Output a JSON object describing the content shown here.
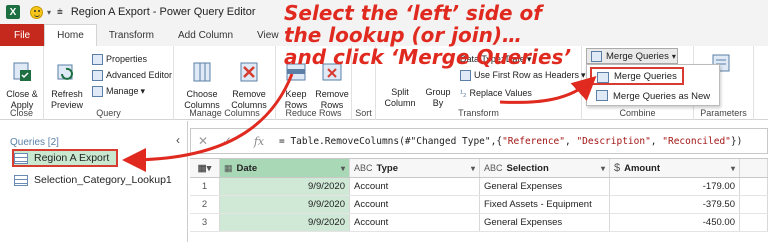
{
  "titlebar": {
    "title": "Region A Export - Power Query Editor",
    "app_logo": "X"
  },
  "tabs": [
    "File",
    "Home",
    "Transform",
    "Add Column",
    "View"
  ],
  "ribbon": {
    "close": {
      "close_apply": "Close &\nApply",
      "group": "Close"
    },
    "query": {
      "refresh": "Refresh\nPreview",
      "properties": "Properties",
      "advanced_editor": "Advanced Editor",
      "manage": "Manage",
      "group": "Query"
    },
    "manage_columns": {
      "choose": "Choose\nColumns",
      "remove": "Remove\nColumns",
      "group": "Manage Columns"
    },
    "reduce_rows": {
      "keep": "Keep\nRows",
      "remove": "Remove\nRows",
      "group": "Reduce Rows"
    },
    "sort": {
      "group": "Sort"
    },
    "transform": {
      "split": "Split\nColumn",
      "group_by": "Group\nBy",
      "data_type": "Data Type: Date",
      "first_row": "Use First Row as Headers",
      "replace": "Replace Values",
      "group": "Transform"
    },
    "combine": {
      "merge_queries": "Merge Queries",
      "group": "Combine"
    },
    "parameters": {
      "group": "Parameters"
    }
  },
  "merge_menu": {
    "items": [
      "Merge Queries",
      "Merge Queries as New"
    ]
  },
  "annotation": {
    "line1": "Select the ‘left’ side of",
    "line2": "the lookup (or join)…",
    "line3": "and click ‘Merge Queries’"
  },
  "queries": {
    "header": "Queries [2]",
    "items": [
      "Region A Export",
      "Selection_Category_Lookup1"
    ]
  },
  "formula": {
    "prefix": "= Table.RemoveColumns(#\"Changed Type\",{",
    "s1": "\"Reference\"",
    "s2": "\"Description\"",
    "s3": "\"Reconciled\"",
    "suffix": "})"
  },
  "grid": {
    "headers": [
      {
        "icon": "calendar-table-icon",
        "label": "Date"
      },
      {
        "icon": "ABC",
        "label": "Type"
      },
      {
        "icon": "ABC",
        "label": "Selection"
      },
      {
        "icon": "$",
        "label": "Amount"
      }
    ],
    "rows": [
      {
        "idx": "1",
        "date": "9/9/2020",
        "type": "Account",
        "selection": "General Expenses",
        "amount": "-179.00"
      },
      {
        "idx": "2",
        "date": "9/9/2020",
        "type": "Account",
        "selection": "Fixed Assets - Equipment",
        "amount": "-379.50"
      },
      {
        "idx": "3",
        "date": "9/9/2020",
        "type": "Account",
        "selection": "General Expenses",
        "amount": "-450.00"
      }
    ]
  },
  "colors": {
    "accent_red": "#e02a1f",
    "excel_green": "#1d6f42",
    "file_tab": "#c5281c",
    "selected_green": "#c9e8d0"
  }
}
